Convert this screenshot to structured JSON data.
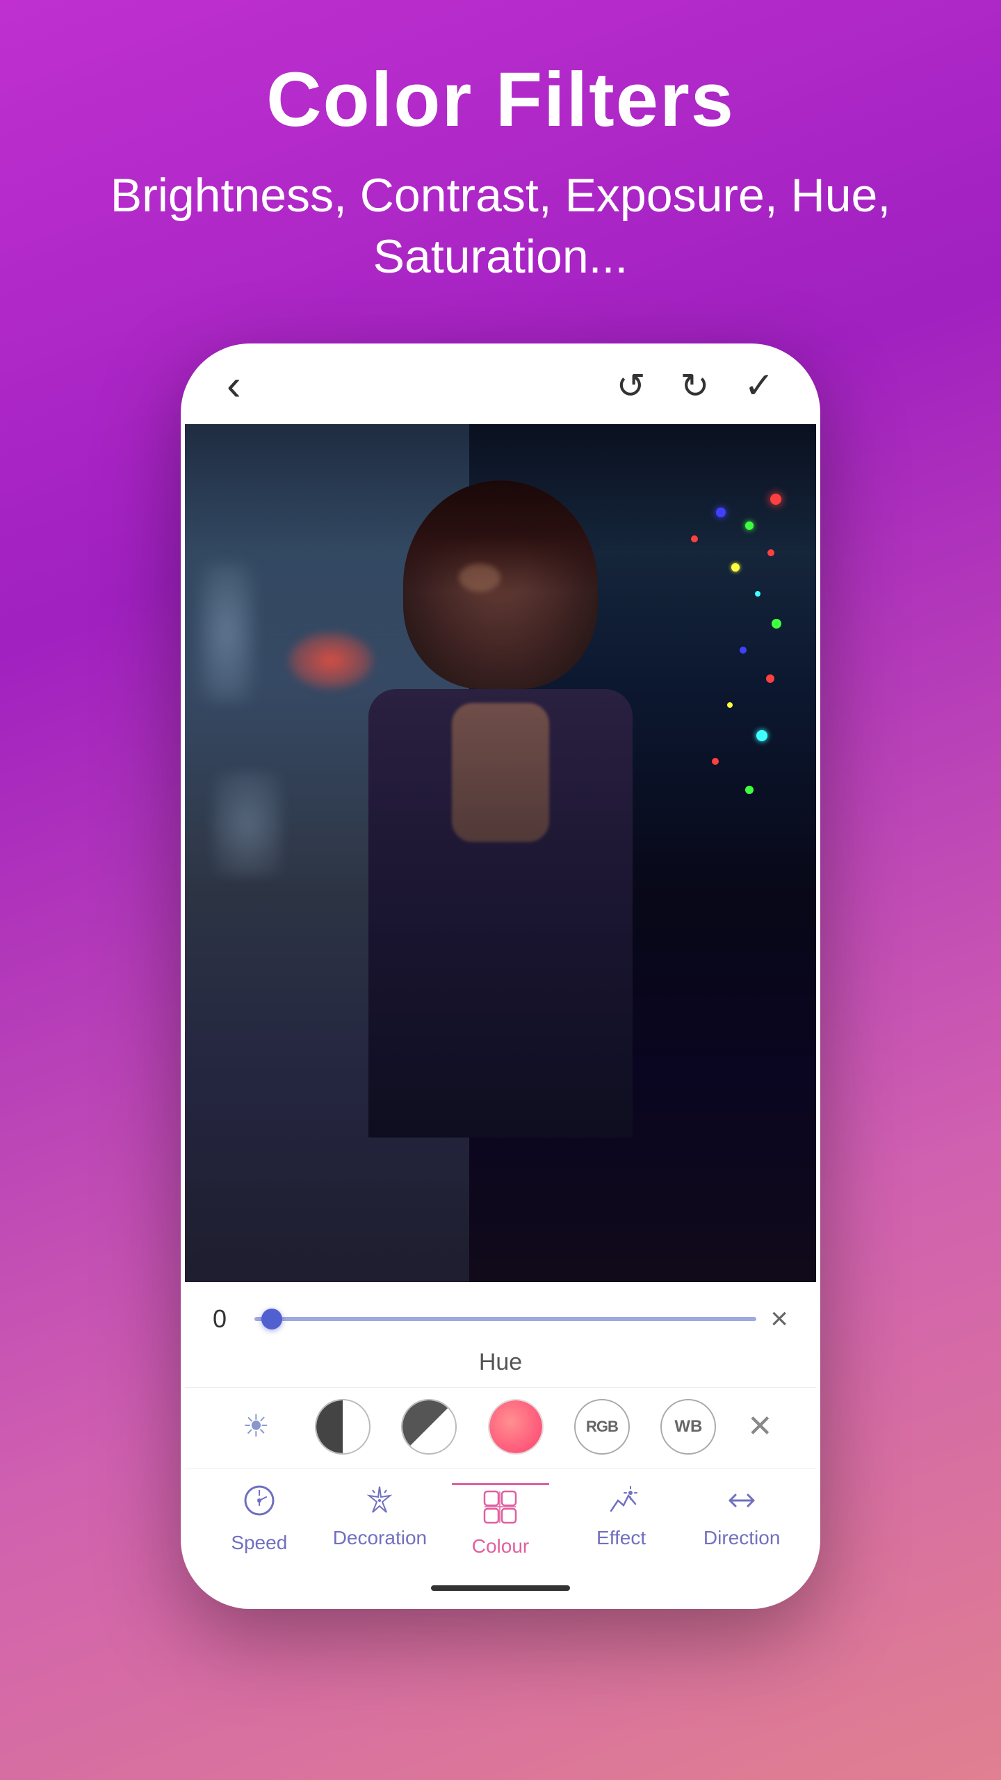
{
  "title": "Color Filters",
  "subtitle": "Brightness, Contrast, Exposure, Hue, Saturation...",
  "phone": {
    "topbar": {
      "back_icon": "‹",
      "undo_icon": "↺",
      "redo_icon": "↻",
      "confirm_icon": "✓"
    },
    "slider": {
      "value": "0",
      "label": "Hue",
      "close_icon": "×"
    },
    "filter_icons": [
      {
        "id": "sun",
        "label": "brightness"
      },
      {
        "id": "contrast",
        "label": "contrast"
      },
      {
        "id": "halfmoon",
        "label": "exposure"
      },
      {
        "id": "hue",
        "label": "hue"
      },
      {
        "id": "rgb",
        "label": "RGB"
      },
      {
        "id": "wb",
        "label": "WB"
      },
      {
        "id": "close",
        "label": "close"
      }
    ],
    "nav_items": [
      {
        "id": "speed",
        "label": "Speed",
        "icon": "⊙",
        "active": false
      },
      {
        "id": "decoration",
        "label": "Decoration",
        "icon": "✦",
        "active": false
      },
      {
        "id": "colour",
        "label": "Colour",
        "icon": "⊞",
        "active": true
      },
      {
        "id": "effect",
        "label": "Effect",
        "icon": "✦",
        "active": false
      },
      {
        "id": "direction",
        "label": "Direction",
        "icon": "⇔",
        "active": false
      }
    ]
  },
  "colors": {
    "background_start": "#c030d0",
    "background_end": "#e08090",
    "accent_purple": "#7070c0",
    "accent_pink": "#e060a0"
  }
}
